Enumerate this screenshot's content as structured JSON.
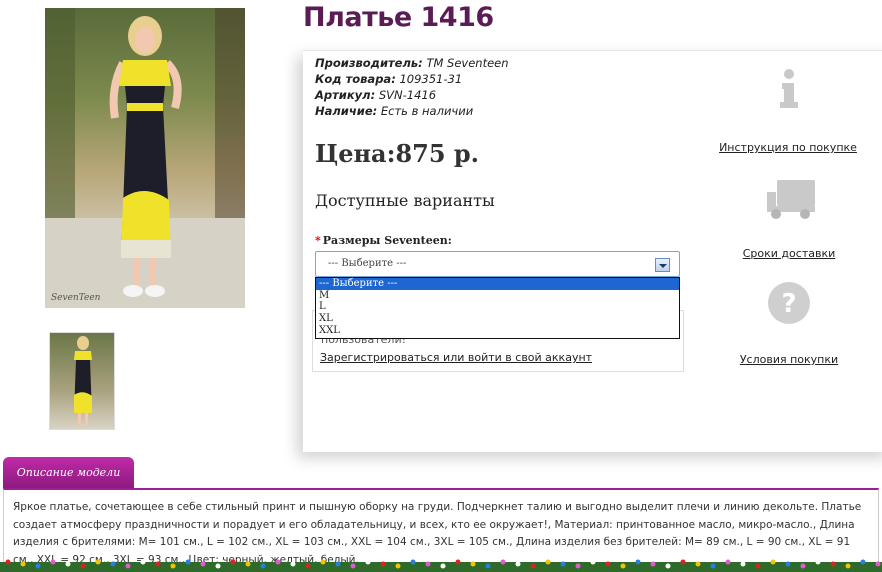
{
  "product": {
    "title": "Платье 1416",
    "meta": [
      {
        "key": "Производитель:",
        "value": "TM Seventeen"
      },
      {
        "key": "Код товара:",
        "value": "109351-31"
      },
      {
        "key": "Артикул:",
        "value": "SVN-1416"
      },
      {
        "key": "Наличие:",
        "value": "Есть в наличии"
      }
    ],
    "price": "Цена:875 р.",
    "variants_title": "Доступные варианты",
    "size_label": "Размеры Seventeen:",
    "required_mark": "*",
    "select_value": "--- Выберите ---",
    "options": [
      "--- Выберите ---",
      "M",
      "L",
      "XL",
      "XXL"
    ]
  },
  "login": {
    "note": "пользователи!",
    "link": "Зарегистрироваться или войти в свой аккаунт"
  },
  "side": {
    "instruction": "Инструкция по покупке",
    "delivery": "Сроки доставки",
    "conditions": "Условия покупки"
  },
  "description": {
    "tab": "Описание модели",
    "text": "Яркое платье, сочетающее в себе стильный принт и пышную оборку на груди. Подчеркнет талию и выгодно выделит плечи и линию декольте. Платье создает атмосферу праздничности и порадует и его обладательницу, и всех, кто ее окружает!, Материал: принтованное масло, микро-масло., Длина изделия с брителями: M= 101 см., L = 102 см., XL = 103 см., XXL = 104 см., 3XL = 105 см., Длина изделия без брителей: M= 89 см., L = 90 см., XL = 91 см., XXL = 92 см., 3XL = 93 см., Цвет: черный, желтый, белый."
  },
  "photo": {
    "watermark": "SevenTeen"
  },
  "colors": {
    "title": "#5b1c55",
    "tab": "#a8229a",
    "selected_option": "#1e66d2"
  }
}
